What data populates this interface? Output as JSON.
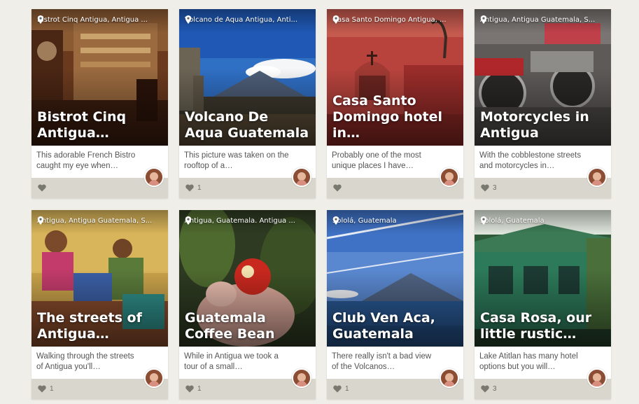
{
  "cards": [
    {
      "location": "Bistrot Cinq Antigua, Antigua ...",
      "title": "Bistrot Cinq Antigua…",
      "description": "This adorable French Bistro caught my eye when…",
      "likes": ""
    },
    {
      "location": "Volcano de Aqua Antigua, Anti...",
      "title": "Volcano De Aqua Guatemala",
      "description": "This picture was taken on the rooftop of a…",
      "likes": "1"
    },
    {
      "location": "Casa Santo Domingo Antigua, ...",
      "title": "Casa Santo Domingo hotel in…",
      "description": "Probably one of the most unique places I have…",
      "likes": ""
    },
    {
      "location": "Antigua, Antigua Guatemala, S...",
      "title": "Motorcycles in Antigua",
      "description": "With the cobblestone streets and motorcycles in…",
      "likes": "3"
    },
    {
      "location": "Antigua, Antigua Guatemala, S...",
      "title": "The streets of Antigua…",
      "description": "Walking through the streets of Antigua you'll…",
      "likes": "1"
    },
    {
      "location": "Antigua, Guatemala. Antigua ...",
      "title": "Guatemala Coffee Bean",
      "description": "While in Antigua we took a tour of a small…",
      "likes": "1"
    },
    {
      "location": "Sololá, Guatemala",
      "title": "Club Ven Aca, Guatemala",
      "description": "There really isn't a bad view of the Volcanos…",
      "likes": "1"
    },
    {
      "location": "Sololá, Guatemala",
      "title": "Casa Rosa, our little rustic…",
      "description": "Lake Atitlan has many hotel options but you will…",
      "likes": "3"
    }
  ],
  "icons": {
    "location": "map-pin-icon",
    "like": "heart-icon",
    "author": "avatar"
  },
  "colors": {
    "background": "#efeee8",
    "card_footer": "#d9d7cd",
    "heart": "#7a7970"
  }
}
